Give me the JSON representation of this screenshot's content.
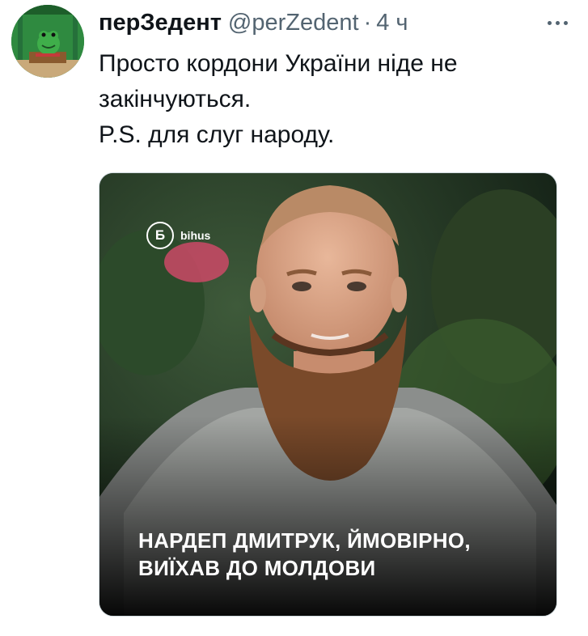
{
  "tweet": {
    "author_name": "перЗедент",
    "author_handle": "@perZedent",
    "separator": "·",
    "time": "4 ч",
    "text_lines": [
      "Просто кордони України ніде не",
      "закінчуються.",
      "P.S. для слуг народу."
    ]
  },
  "media": {
    "brand_logo": "Б",
    "brand_name": "bihus",
    "caption_lines": [
      "НАРДЕП ДМИТРУК, ЙМОВІРНО,",
      "ВИЇХАВ ДО МОЛДОВИ"
    ]
  },
  "icons": {
    "more": "more-horizontal-icon",
    "avatar": "frog-avatar-icon"
  },
  "colors": {
    "name": "#0f1419",
    "secondary_text": "#536471",
    "border": "#cfd9de",
    "avatar_bg": "#2a7d3a"
  }
}
